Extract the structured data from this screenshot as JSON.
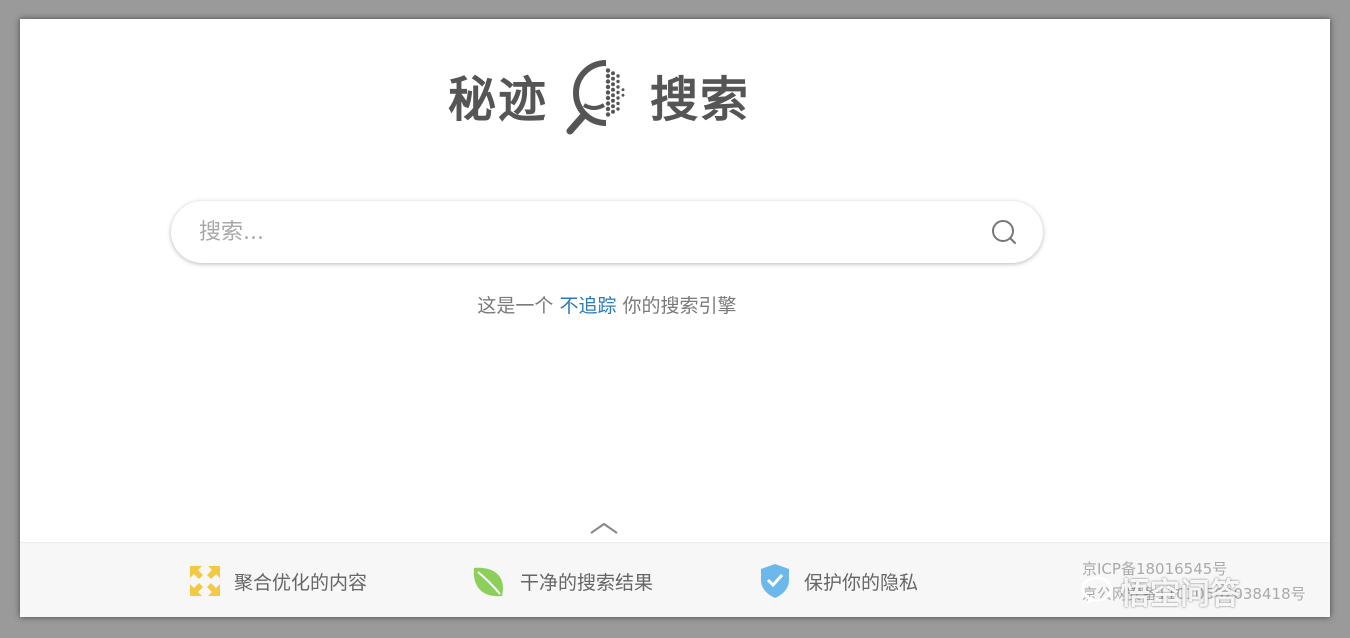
{
  "logo": {
    "left_text": "秘迹",
    "right_text": "搜索"
  },
  "search": {
    "placeholder": "搜索..."
  },
  "tagline": {
    "prefix": "这是一个",
    "highlight": "不追踪",
    "suffix": "你的搜索引擎"
  },
  "footer": {
    "features": [
      {
        "label": "聚合优化的内容",
        "icon": "arrows-in-icon",
        "color": "#f5c842"
      },
      {
        "label": "干净的搜索结果",
        "icon": "leaf-icon",
        "color": "#8ccf5a"
      },
      {
        "label": "保护你的隐私",
        "icon": "shield-check-icon",
        "color": "#6cb8ea"
      }
    ],
    "icp_line1": "京ICP备18016545号",
    "icp_line2": "京公网安备11010502038418号"
  },
  "watermark": {
    "text": "悟空问答"
  },
  "colors": {
    "accent": "#2b7bb9",
    "logo": "#555555"
  }
}
